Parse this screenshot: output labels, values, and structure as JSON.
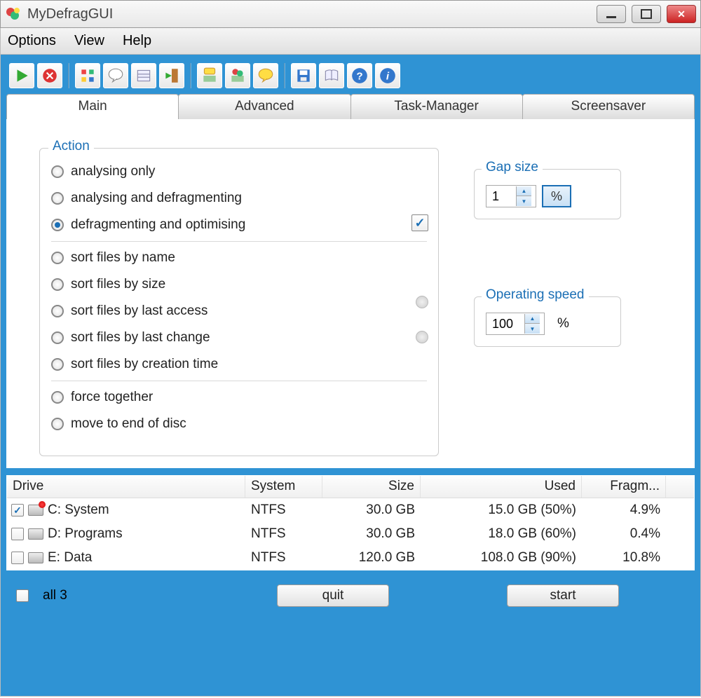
{
  "window": {
    "title": "MyDefragGUI"
  },
  "menu": {
    "options": "Options",
    "view": "View",
    "help": "Help"
  },
  "tabs": {
    "main": "Main",
    "advanced": "Advanced",
    "taskmgr": "Task-Manager",
    "screensaver": "Screensaver"
  },
  "action": {
    "legend": "Action",
    "items": [
      "analysing only",
      "analysing and defragmenting",
      "defragmenting and optimising",
      "sort files by name",
      "sort files by size",
      "sort files by last access",
      "sort files by last change",
      "sort files by creation time",
      "force together",
      "move to end of disc"
    ],
    "selected_index": 2
  },
  "gap_size": {
    "legend": "Gap size",
    "value": "1",
    "unit": "%"
  },
  "operating_speed": {
    "legend": "Operating speed",
    "value": "100",
    "unit": "%"
  },
  "drives": {
    "headers": {
      "drive": "Drive",
      "system": "System",
      "size": "Size",
      "used": "Used",
      "fragm": "Fragm..."
    },
    "rows": [
      {
        "checked": true,
        "icon": "sys",
        "name": "C: System",
        "system": "NTFS",
        "size": "30.0 GB",
        "used": "15.0 GB (50%)",
        "fragm": "4.9%"
      },
      {
        "checked": false,
        "icon": "plain",
        "name": "D: Programs",
        "system": "NTFS",
        "size": "30.0 GB",
        "used": "18.0 GB (60%)",
        "fragm": "0.4%"
      },
      {
        "checked": false,
        "icon": "plain",
        "name": "E: Data",
        "system": "NTFS",
        "size": "120.0 GB",
        "used": "108.0 GB (90%)",
        "fragm": "10.8%"
      }
    ]
  },
  "bottom": {
    "all_label": "all 3",
    "quit": "quit",
    "start": "start"
  }
}
